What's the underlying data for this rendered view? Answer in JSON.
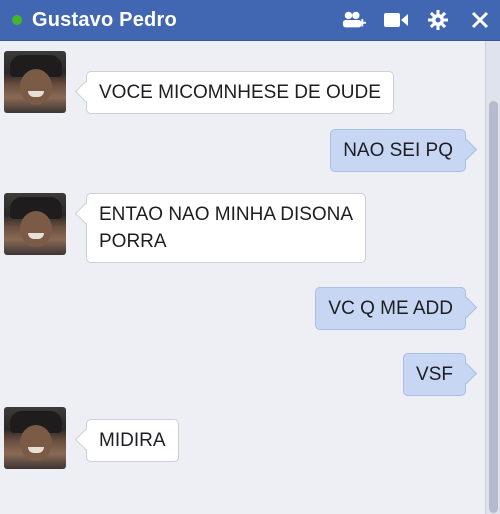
{
  "header": {
    "contact_name": "Gustavo Pedro",
    "status_color": "#42b72a",
    "icons": [
      "add-friends-icon",
      "video-call-icon",
      "settings-gear-icon",
      "close-icon"
    ]
  },
  "messages": [
    {
      "direction": "incoming",
      "text": "VOCE MICOMNHESE DE OUDE"
    },
    {
      "direction": "outgoing",
      "text": "NAO SEI PQ"
    },
    {
      "direction": "incoming",
      "lines": [
        "ENTAO NAO MINHA  DISONA",
        "PORRA"
      ]
    },
    {
      "direction": "outgoing",
      "text": "VC Q ME ADD"
    },
    {
      "direction": "outgoing",
      "text": "VSF"
    },
    {
      "direction": "incoming",
      "text": "MIDIRA"
    }
  ]
}
